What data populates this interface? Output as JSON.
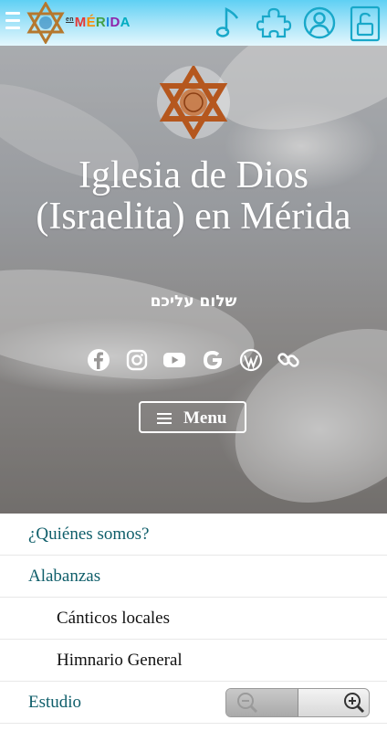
{
  "topbar": {
    "brand_prefix": "en",
    "brand_letters": [
      "M",
      "É",
      "R",
      "I",
      "D",
      "A"
    ],
    "brand_colors": [
      "#e53935",
      "#fb8c00",
      "#43a047",
      "#1e88e5",
      "#8e24aa",
      "#00acc1"
    ],
    "icons": [
      "music-note-icon",
      "puzzle-piece-icon",
      "user-account-icon",
      "unlock-login-icon"
    ],
    "icon_color": "#18a8c9"
  },
  "hero": {
    "title": "Iglesia de Dios (Israelita) en Mérida",
    "tagline": "שלום עליכם",
    "social_icons": [
      "facebook-icon",
      "instagram-icon",
      "youtube-icon",
      "google-icon",
      "wordpress-icon",
      "link-icon"
    ],
    "menu_label": "Menu"
  },
  "nav": {
    "items": [
      {
        "label": "¿Quiénes somos?",
        "level": 1
      },
      {
        "label": "Alabanzas",
        "level": 1
      },
      {
        "label": "Cánticos locales",
        "level": 2
      },
      {
        "label": "Himnario General",
        "level": 2
      },
      {
        "label": "Estudio",
        "level": 1
      }
    ],
    "link_color": "#0f5e6a"
  },
  "zoom": {
    "zoom_out_icon": "zoom-out-icon",
    "zoom_in_icon": "zoom-in-icon"
  }
}
